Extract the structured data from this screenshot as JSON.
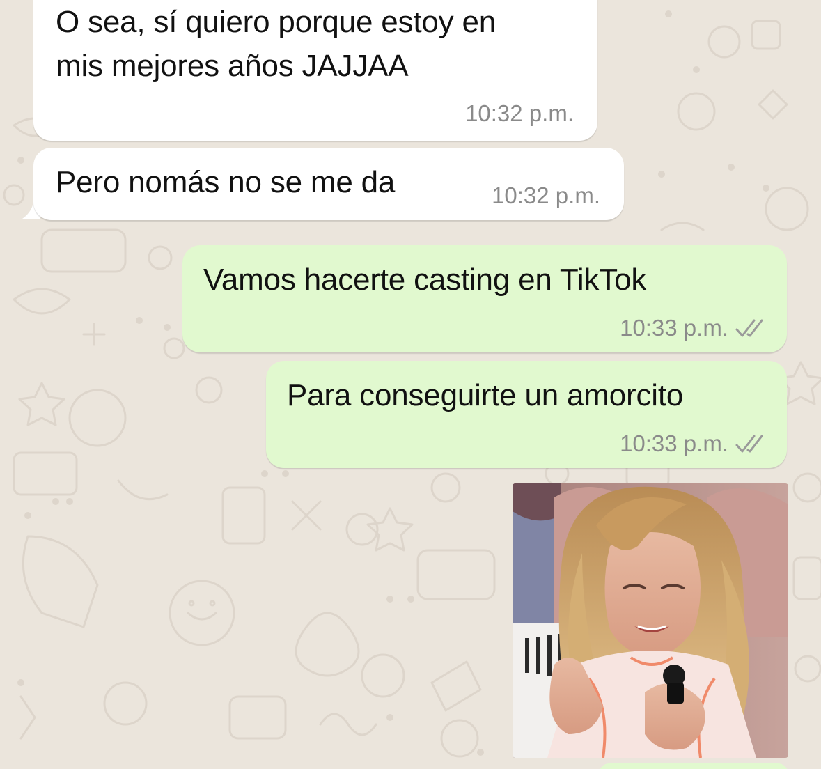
{
  "messages": [
    {
      "direction": "incoming",
      "text": "O sea, sí quiero porque estoy en\nmis mejores años JAJJAA",
      "time": "10:32 p.m."
    },
    {
      "direction": "incoming",
      "text": "Pero nomás no se me da",
      "time": "10:32 p.m."
    },
    {
      "direction": "outgoing",
      "text": "Vamos hacerte casting en TikTok",
      "time": "10:33 p.m.",
      "status_icon": "double-check-icon"
    },
    {
      "direction": "outgoing",
      "text": "Para conseguirte un amorcito",
      "time": "10:33 p.m.",
      "status_icon": "double-check-icon"
    },
    {
      "direction": "outgoing",
      "type": "image",
      "content": "sticker-image"
    }
  ],
  "colors": {
    "incoming_bubble": "#ffffff",
    "outgoing_bubble": "#e1f9cf",
    "wallpaper": "#ebe5dc",
    "timestamp": "#8a8a8a"
  }
}
